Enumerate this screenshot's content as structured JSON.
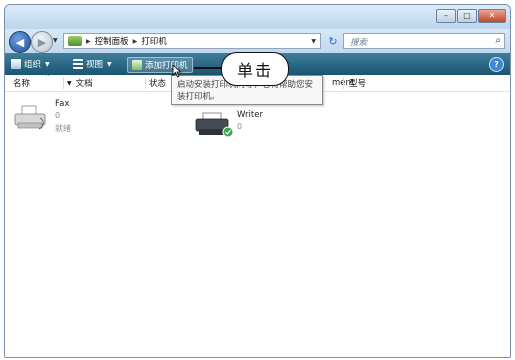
{
  "titlebar": {
    "buttons": {
      "minimize": "–",
      "maximize": "□",
      "close": "✕"
    }
  },
  "nav": {
    "breadcrumbs": [
      "控制面板",
      "打印机"
    ],
    "search_placeholder": "搜索"
  },
  "toolbar": {
    "organize_label": "组织",
    "views_label": "视图",
    "add_printer_label": "添加打印机"
  },
  "columns": {
    "name": "名称",
    "documents": "文档",
    "status": "状态",
    "comments": "ment",
    "model": "型号"
  },
  "items": [
    {
      "name": "Fax",
      "count": "0",
      "status": "就绪"
    },
    {
      "name": "Writer",
      "count": "0"
    }
  ],
  "tooltip": {
    "line1": "启动安装打印机向导，它将帮助您安",
    "line2": "装打印机。"
  },
  "callout": {
    "label": "单击"
  },
  "colors": {
    "toolbar_bg": "#1a5470",
    "window_frame": "#c9dff0",
    "close_button": "#c2472d"
  }
}
